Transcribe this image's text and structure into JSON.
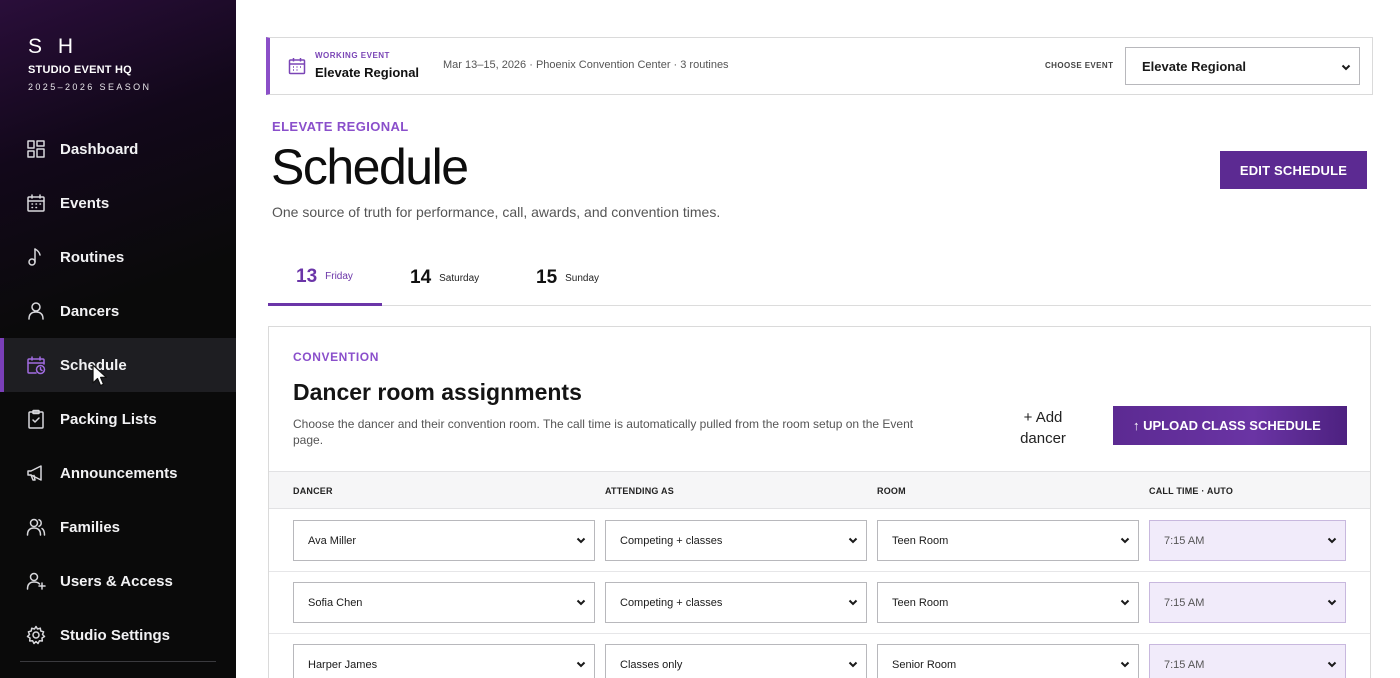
{
  "brand": {
    "mark": "S H",
    "name": "STUDIO EVENT HQ",
    "season": "2025–2026 SEASON"
  },
  "sidebar": {
    "items": [
      {
        "label": "Dashboard",
        "icon": "dashboard-icon"
      },
      {
        "label": "Events",
        "icon": "calendar-icon"
      },
      {
        "label": "Routines",
        "icon": "music-note-icon"
      },
      {
        "label": "Dancers",
        "icon": "person-icon"
      },
      {
        "label": "Schedule",
        "icon": "calendar-clock-icon",
        "active": true
      },
      {
        "label": "Packing Lists",
        "icon": "clipboard-check-icon"
      },
      {
        "label": "Announcements",
        "icon": "megaphone-icon"
      },
      {
        "label": "Families",
        "icon": "people-icon"
      },
      {
        "label": "Users & Access",
        "icon": "user-plus-icon"
      },
      {
        "label": "Studio Settings",
        "icon": "gear-icon"
      }
    ]
  },
  "topbar": {
    "kicker": "WORKING EVENT",
    "title": "Elevate Regional",
    "meta": "Mar 13–15, 2026 · Phoenix Convention Center · 3 routines",
    "choose_label": "CHOOSE EVENT",
    "selected_event": "Elevate Regional"
  },
  "page": {
    "eyebrow": "ELEVATE REGIONAL",
    "title": "Schedule",
    "subtitle": "One source of truth for performance, call, awards, and convention times.",
    "edit_button": "EDIT SCHEDULE"
  },
  "tabs": [
    {
      "num": "13",
      "day": "Friday",
      "active": true
    },
    {
      "num": "14",
      "day": "Saturday"
    },
    {
      "num": "15",
      "day": "Sunday"
    }
  ],
  "card": {
    "eyebrow": "CONVENTION",
    "title": "Dancer room assignments",
    "description": "Choose the dancer and their convention room. The call time is automatically pulled from the room setup on the Event page.",
    "add_button": "+ Add dancer",
    "upload_button": "↑ UPLOAD CLASS SCHEDULE",
    "columns": [
      "DANCER",
      "ATTENDING AS",
      "ROOM",
      "CALL TIME · AUTO"
    ],
    "rows": [
      {
        "dancer": "Ava Miller",
        "attending": "Competing + classes",
        "room": "Teen Room",
        "call_time": "7:15 AM"
      },
      {
        "dancer": "Sofia Chen",
        "attending": "Competing + classes",
        "room": "Teen Room",
        "call_time": "7:15 AM"
      },
      {
        "dancer": "Harper James",
        "attending": "Classes only",
        "room": "Senior Room",
        "call_time": "7:15 AM"
      }
    ]
  },
  "colors": {
    "accent": "#5c2a92",
    "accent_light": "#8a4fcb",
    "sidebar_bg": "#0a0a0a",
    "call_time_bg": "#f1ebfa"
  }
}
